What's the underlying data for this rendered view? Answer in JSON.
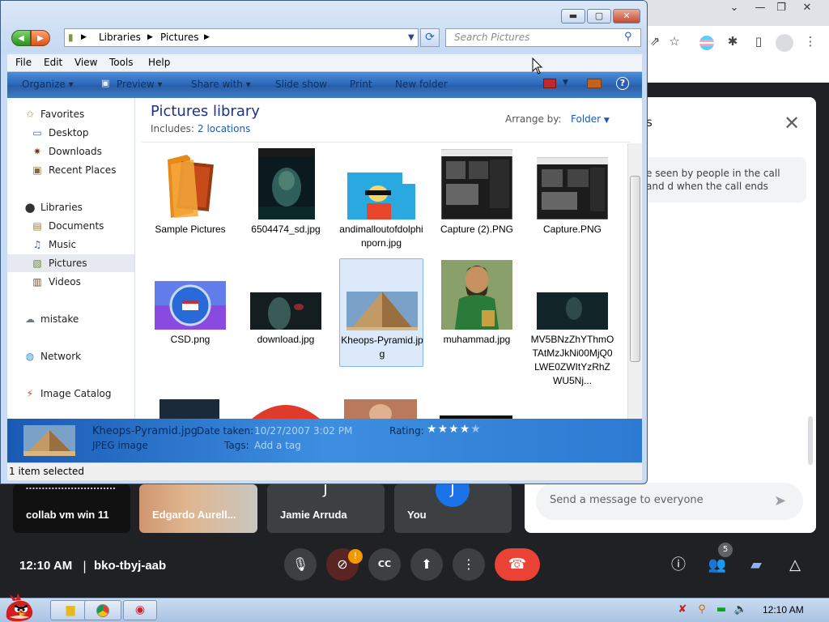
{
  "explorer": {
    "breadcrumb": [
      "Libraries",
      "Pictures"
    ],
    "search_placeholder": "Search Pictures",
    "menu": [
      "File",
      "Edit",
      "View",
      "Tools",
      "Help"
    ],
    "commands": [
      "Organize",
      "Preview",
      "Share with",
      "Slide show",
      "Print",
      "New folder"
    ],
    "nav": {
      "favorites": "Favorites",
      "desktop": "Desktop",
      "downloads": "Downloads",
      "recent": "Recent Places",
      "libraries": "Libraries",
      "documents": "Documents",
      "music": "Music",
      "pictures": "Pictures",
      "videos": "Videos",
      "mistake": "mistake",
      "network": "Network",
      "image_catalog": "Image Catalog"
    },
    "library_title": "Pictures library",
    "includes_label": "Includes:",
    "includes_value": "2 locations",
    "arrange_label": "Arrange by:",
    "arrange_value": "Folder",
    "files": [
      "Sample Pictures",
      "6504474_sd.jpg",
      "andimalloutofdolphinporn.jpg",
      "Capture (2).PNG",
      "Capture.PNG",
      "CSD.png",
      "download.jpg",
      "Kheops-Pyramid.jpg",
      "muhammad.jpg",
      "MV5BNzZhYThmOTAtMzJkNi00MjQ0LWE0ZWItYzRhZWU5Nj..."
    ],
    "details": {
      "filename": "Kheops-Pyramid.jpg",
      "filetype": "JPEG image",
      "date_label": "Date taken:",
      "date_value": "10/27/2007 3:02 PM",
      "tags_label": "Tags:",
      "tags_value": "Add a tag",
      "rating_label": "Rating:",
      "rating": 4,
      "rating_max": 5
    },
    "status": "1 item selected"
  },
  "meet": {
    "chat_title_fragment": "s",
    "chat_notice": "e seen by people in the call and d when the call ends",
    "chat_placeholder": "Send a message to everyone",
    "tiles": [
      {
        "name": "collab vm win 11"
      },
      {
        "name": "Edgardo Aurell..."
      },
      {
        "name": "Jamie Arruda",
        "initial": "J"
      },
      {
        "name": "You",
        "initial": "J"
      }
    ],
    "time": "12:10 AM",
    "meeting_code": "bko-tbyj-aab",
    "camera_alert": "!",
    "participants_count": "5"
  },
  "taskbar": {
    "time": "12:10 AM"
  },
  "colors": {
    "end_call": "#ea4335",
    "meet_bg": "#202124",
    "library_title": "#1e3287",
    "link_blue": "#1a5ab8"
  }
}
